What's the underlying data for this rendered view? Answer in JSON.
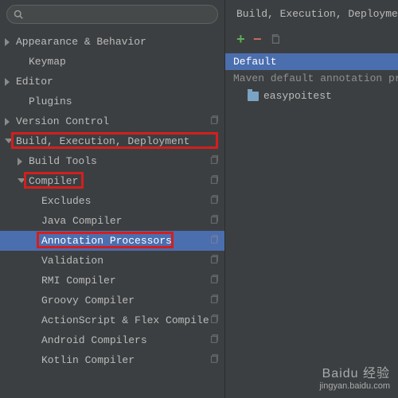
{
  "search": {
    "placeholder": ""
  },
  "tree": {
    "items": [
      {
        "label": "Appearance & Behavior",
        "indent": 0,
        "arrow": "closed",
        "copy": false
      },
      {
        "label": "Keymap",
        "indent": 1,
        "arrow": "none",
        "copy": false
      },
      {
        "label": "Editor",
        "indent": 0,
        "arrow": "closed",
        "copy": false
      },
      {
        "label": "Plugins",
        "indent": 1,
        "arrow": "none",
        "copy": false
      },
      {
        "label": "Version Control",
        "indent": 0,
        "arrow": "closed",
        "copy": true
      },
      {
        "label": "Build, Execution, Deployment",
        "indent": 0,
        "arrow": "open",
        "copy": false,
        "highlight": true
      },
      {
        "label": "Build Tools",
        "indent": 1,
        "arrow": "closed",
        "copy": true
      },
      {
        "label": "Compiler",
        "indent": 1,
        "arrow": "open",
        "copy": true,
        "highlight": true
      },
      {
        "label": "Excludes",
        "indent": 2,
        "arrow": "none",
        "copy": true
      },
      {
        "label": "Java Compiler",
        "indent": 2,
        "arrow": "none",
        "copy": true
      },
      {
        "label": "Annotation Processors",
        "indent": 2,
        "arrow": "none",
        "copy": true,
        "selected": true,
        "highlight": true
      },
      {
        "label": "Validation",
        "indent": 2,
        "arrow": "none",
        "copy": true
      },
      {
        "label": "RMI Compiler",
        "indent": 2,
        "arrow": "none",
        "copy": true
      },
      {
        "label": "Groovy Compiler",
        "indent": 2,
        "arrow": "none",
        "copy": true
      },
      {
        "label": "ActionScript & Flex Compiler",
        "indent": 2,
        "arrow": "none",
        "copy": true
      },
      {
        "label": "Android Compilers",
        "indent": 2,
        "arrow": "none",
        "copy": true
      },
      {
        "label": "Kotlin Compiler",
        "indent": 2,
        "arrow": "none",
        "copy": true
      }
    ]
  },
  "right": {
    "breadcrumb": "Build, Execution, Deployment",
    "profile_selected": "Default",
    "profile_desc": "Maven default annotation processors",
    "module": "easypoitest"
  },
  "watermark": {
    "brand": "Baidu 经验",
    "url": "jingyan.baidu.com"
  }
}
